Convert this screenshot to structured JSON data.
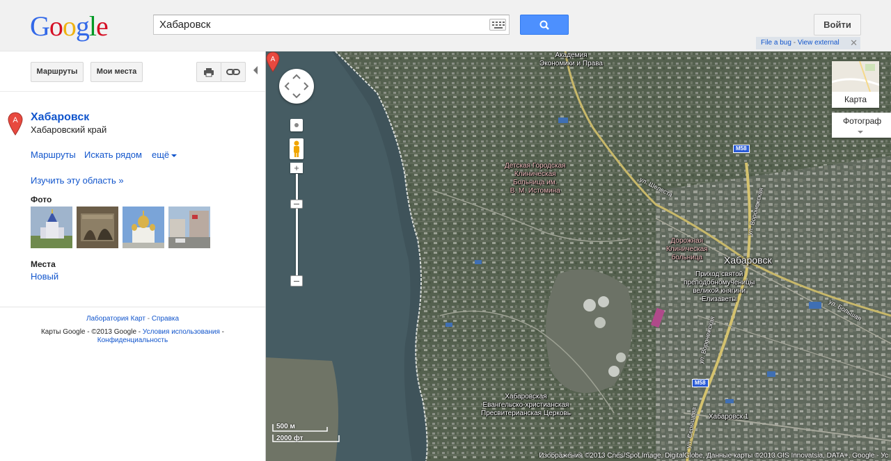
{
  "header": {
    "logo_letters": [
      "G",
      "o",
      "o",
      "g",
      "l",
      "e"
    ],
    "logo_colors": [
      "#3369e8",
      "#d50f25",
      "#eeb211",
      "#3369e8",
      "#009925",
      "#d50f25"
    ],
    "search_value": "Хабаровск",
    "signin_label": "Войти",
    "bug_link": "File a bug",
    "bug_sep": " - ",
    "bug_view": "View external",
    "bug_close": "✕"
  },
  "toolbar": {
    "routes_label": "Маршруты",
    "myplaces_label": "Мои места",
    "print_icon": "print-icon",
    "link_icon": "link-icon"
  },
  "place": {
    "pin_letter": "A",
    "title": "Хабаровск",
    "subtitle": "Хабаровский край",
    "link_routes": "Маршруты",
    "link_nearby": "Искать рядом",
    "link_more": "ещё",
    "link_explore": "Изучить эту область »",
    "photos_heading": "Фото",
    "places_heading": "Места",
    "places_new": "Новый"
  },
  "footer": {
    "labs": "Лаборатория Карт",
    "dash": " - ",
    "help": "Справка",
    "copyright": "Карты Google - ©2013 Google - ",
    "terms": "Условия использования",
    "dash2": " - ",
    "privacy": "Конфиденциальность"
  },
  "map": {
    "layer_map_label": "Карта",
    "layer_photo_label": "Фотограф",
    "scale_metric": "500 м",
    "scale_imperial": "2000 фт",
    "attribution": "Изображения ©2013 Cnes/Spot Image, DigitalGlobe, Данные карты ©2013 GIS Innovatsia, DATA+, Google - Ус",
    "marker_letter": "A",
    "marker_label": "Хабаровск",
    "labels": {
      "academy": "Академия\nЭкономики и Права",
      "hospital_child": "Детская Городская\nКлиническая\nБольница им.\nВ. М. Истомина",
      "hospital_road": "Дорожная\nКлиническая\nбольница",
      "church": "Приход святой\nпреподобномученицы\nвеликой княгини\nЕлизаветы",
      "baptist": "Хабаровская\nЕвангельско-христианская\nПресвитерианская Церковь",
      "street_shelesta": "ул. Шелеста",
      "street_voronezh1": "ул. Воронежская",
      "street_voronezh2": "ул. Воронежская",
      "street_bolshaya": "ул. Большая",
      "street_serysheva": "ул. Серышева",
      "khabarovsk1": "Хабаровск 1",
      "m58_a": "M58",
      "m58_b": "M58"
    }
  }
}
